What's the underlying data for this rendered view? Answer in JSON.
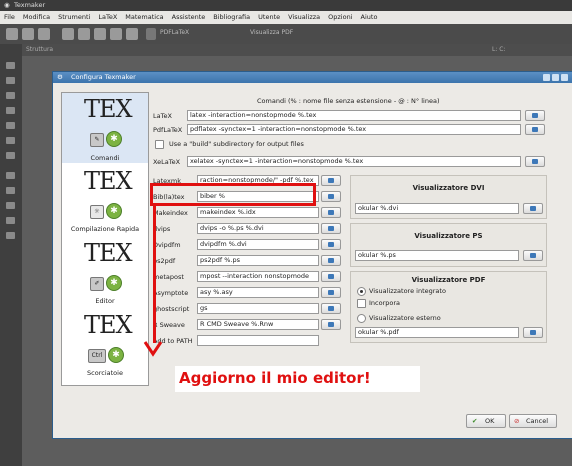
{
  "window": {
    "title": "Texmaker"
  },
  "menubar": [
    "File",
    "Modifica",
    "Strumenti",
    "LaTeX",
    "Matematica",
    "Assistente",
    "Bibliografia",
    "Utente",
    "Visualizza",
    "Opzioni",
    "Aiuto"
  ],
  "toolbar": {
    "run1": "PDFLaTeX",
    "run2": "Visualizza PDF"
  },
  "structure": {
    "label": "Struttura",
    "line_col": "L: C:"
  },
  "dialog": {
    "title": "Configura Texmaker",
    "categories": [
      {
        "label": "Comandi",
        "icon": "tex-wrench-icon",
        "selected": true
      },
      {
        "label": "Compilazione Rapida",
        "icon": "tex-gear-icon",
        "selected": false
      },
      {
        "label": "Editor",
        "icon": "tex-pencil-icon",
        "selected": false
      },
      {
        "label": "Scorciatoie",
        "icon": "tex-ctrl-icon",
        "selected": false
      }
    ],
    "header": "Comandi (% : nome file senza estensione - @ : N° linea)",
    "latex": {
      "label": "LaTeX",
      "value": "latex -interaction=nonstopmode %.tex"
    },
    "pdflatex": {
      "label": "PdfLaTeX",
      "value": "pdflatex -synctex=1 -interaction=nonstopmode %.tex"
    },
    "build_subdir": {
      "label": "Use a \"build\" subdirectory for output files",
      "checked": false
    },
    "xelatex": {
      "label": "XeLaTeX",
      "value": "xelatex -synctex=1 -interaction=nonstopmode %.tex"
    },
    "commands": [
      {
        "label": "Latexmk",
        "value": "raction=nonstopmode/\" -pdf %.tex"
      },
      {
        "label": "Bib(la)tex",
        "value": "biber %"
      },
      {
        "label": "Makeindex",
        "value": "makeindex %.idx"
      },
      {
        "label": "dvips",
        "value": "dvips -o %.ps %.dvi"
      },
      {
        "label": "Dvipdfm",
        "value": "dvipdfm %.dvi"
      },
      {
        "label": "ps2pdf",
        "value": "ps2pdf %.ps"
      },
      {
        "label": "metapost",
        "value": "mpost --interaction nonstopmode"
      },
      {
        "label": "Asymptote",
        "value": "asy %.asy"
      },
      {
        "label": "ghostscript",
        "value": "gs"
      },
      {
        "label": "R Sweave",
        "value": "R CMD Sweave %.Rnw"
      }
    ],
    "add_path": {
      "label": "Add to PATH",
      "value": ""
    },
    "viewer_dvi": {
      "title": "Visualizzatore DVI",
      "value": "okular %.dvi"
    },
    "viewer_ps": {
      "title": "Visualizzatore PS",
      "value": "okular %.ps"
    },
    "viewer_pdf": {
      "title": "Visualizzatore PDF",
      "integrated": "Visualizzatore integrato",
      "embed": "Incorpora",
      "external": "Visualizzatore esterno",
      "value": "okular %.pdf"
    },
    "ok": "OK",
    "cancel": "Cancel"
  },
  "annotation": {
    "text": "Aggiorno il mio editor!",
    "color": "#e01010"
  }
}
